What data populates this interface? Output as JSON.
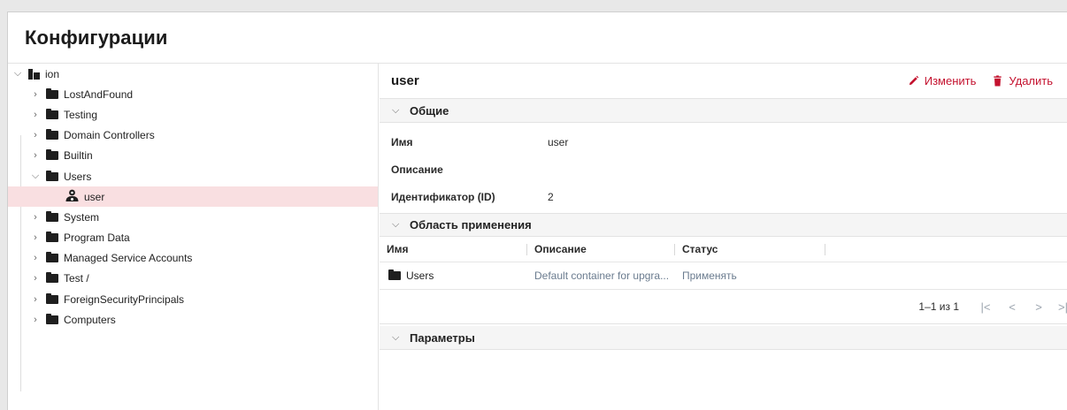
{
  "header": {
    "title": "Конфигурации"
  },
  "tree": {
    "root": {
      "label": "ion"
    },
    "items": [
      {
        "label": "LostAndFound",
        "expanded": false
      },
      {
        "label": "Testing",
        "expanded": false
      },
      {
        "label": "Domain Controllers",
        "expanded": false
      },
      {
        "label": "Builtin",
        "expanded": false
      },
      {
        "label": "Users",
        "expanded": true
      },
      {
        "label": "user",
        "selected": true
      },
      {
        "label": "System",
        "expanded": false
      },
      {
        "label": "Program Data",
        "expanded": false
      },
      {
        "label": "Managed Service Accounts",
        "expanded": false
      },
      {
        "label": "Test /",
        "expanded": false
      },
      {
        "label": "ForeignSecurityPrincipals",
        "expanded": false
      },
      {
        "label": "Computers",
        "expanded": false
      }
    ]
  },
  "detail": {
    "title": "user",
    "edit_label": "Изменить",
    "delete_label": "Удалить",
    "accent_color": "#c4122f",
    "general": {
      "heading": "Общие",
      "props": [
        {
          "key": "Имя",
          "value": "user"
        },
        {
          "key": "Описание",
          "value": ""
        },
        {
          "key": "Идентификатор (ID)",
          "value": "2"
        }
      ]
    },
    "scope": {
      "heading": "Область применения",
      "columns": [
        "Имя",
        "Описание",
        "Статус"
      ],
      "rows": [
        {
          "name": "Users",
          "description": "Default container for upgra...",
          "status": "Применять"
        }
      ],
      "pager_text": "1–1 из 1"
    },
    "params": {
      "heading": "Параметры"
    }
  }
}
